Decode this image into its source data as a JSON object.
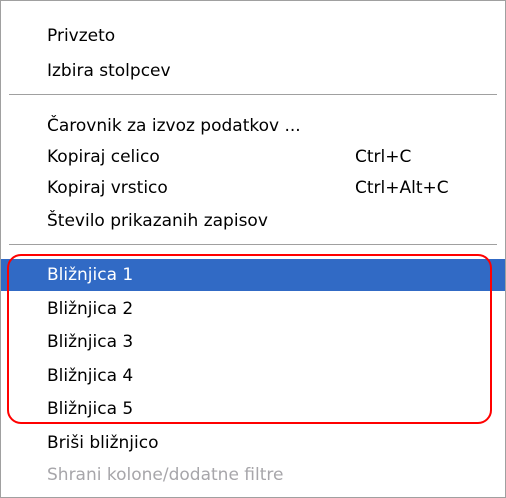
{
  "menu": {
    "items": [
      {
        "label": "Privzeto",
        "shortcut": "",
        "state": "normal"
      },
      {
        "label": "Izbira stolpcev",
        "shortcut": "",
        "state": "normal"
      },
      {
        "label": "Čarovnik za izvoz podatkov ...",
        "shortcut": "",
        "state": "normal"
      },
      {
        "label": "Kopiraj celico",
        "shortcut": "Ctrl+C",
        "state": "normal"
      },
      {
        "label": "Kopiraj vrstico",
        "shortcut": "Ctrl+Alt+C",
        "state": "normal"
      },
      {
        "label": "Število prikazanih zapisov",
        "shortcut": "",
        "state": "normal"
      },
      {
        "label": "Bližnjica 1",
        "shortcut": "",
        "state": "selected"
      },
      {
        "label": "Bližnjica 2",
        "shortcut": "",
        "state": "normal"
      },
      {
        "label": "Bližnjica 3",
        "shortcut": "",
        "state": "normal"
      },
      {
        "label": "Bližnjica 4",
        "shortcut": "",
        "state": "normal"
      },
      {
        "label": "Bližnjica 5",
        "shortcut": "",
        "state": "normal"
      },
      {
        "label": "Briši bližnjico",
        "shortcut": "",
        "state": "normal"
      },
      {
        "label": "Shrani kolone/dodatne filtre",
        "shortcut": "",
        "state": "disabled"
      }
    ]
  },
  "colors": {
    "selection_background": "#316ac5",
    "selection_text": "#ffffff",
    "disabled_text": "#a7a6aa",
    "annotation_outline": "#ff0000"
  }
}
